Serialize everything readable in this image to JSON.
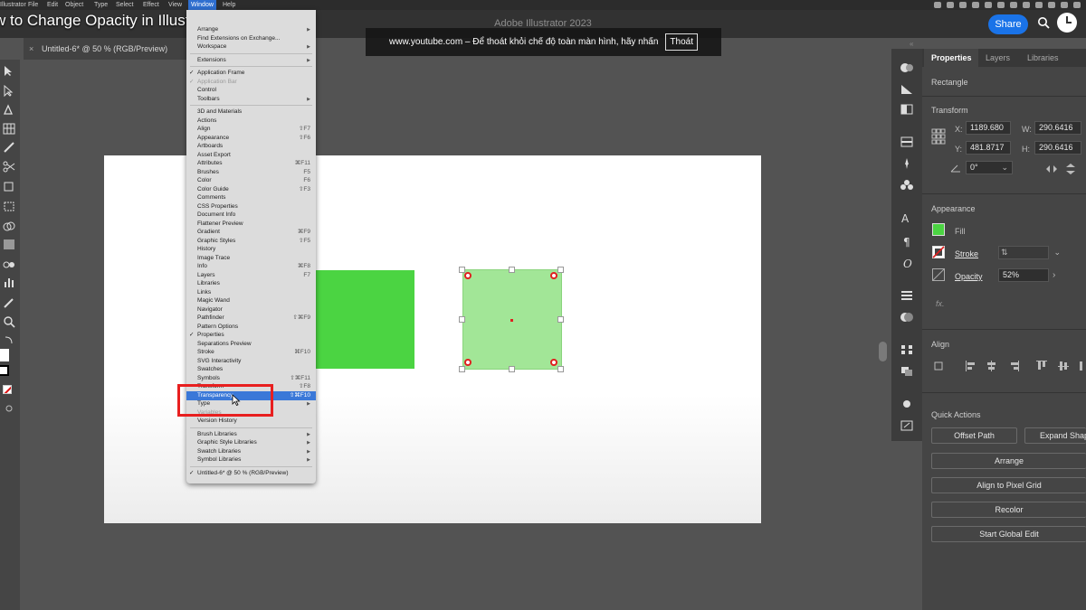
{
  "mac_menubar": {
    "app": "Illustrator",
    "items": [
      "File",
      "Edit",
      "Object",
      "Type",
      "Select",
      "Effect",
      "View",
      "Window",
      "Help"
    ]
  },
  "video_title": "w to Change Opacity in Illustrator",
  "app_title": "Adobe Illustrator 2023",
  "share_label": "Share",
  "fullscreen_notice": {
    "text": "www.youtube.com – Để thoát khỏi chế độ toàn màn hình, hãy nhấn",
    "button": "Thoát"
  },
  "document_tab": {
    "close": "×",
    "title": "Untitled-6* @ 50 % (RGB/Preview)"
  },
  "window_menu": {
    "items": [
      {
        "label": "Arrange",
        "arrow": true
      },
      {
        "label": "Find Extensions on Exchange..."
      },
      {
        "label": "Workspace",
        "arrow": true
      },
      {
        "sep": true
      },
      {
        "label": "Extensions",
        "arrow": true
      },
      {
        "sep": true
      },
      {
        "label": "Application Frame",
        "check": true
      },
      {
        "label": "Application Bar",
        "check": true,
        "disabled": true
      },
      {
        "label": "Control"
      },
      {
        "label": "Toolbars",
        "arrow": true
      },
      {
        "sep": true
      },
      {
        "label": "3D and Materials"
      },
      {
        "label": "Actions"
      },
      {
        "label": "Align",
        "shortcut": "⇧F7"
      },
      {
        "label": "Appearance",
        "shortcut": "⇧F6"
      },
      {
        "label": "Artboards"
      },
      {
        "label": "Asset Export"
      },
      {
        "label": "Attributes",
        "shortcut": "⌘F11"
      },
      {
        "label": "Brushes",
        "shortcut": "F5"
      },
      {
        "label": "Color",
        "shortcut": "F6"
      },
      {
        "label": "Color Guide",
        "shortcut": "⇧F3"
      },
      {
        "label": "Comments"
      },
      {
        "label": "CSS Properties"
      },
      {
        "label": "Document Info"
      },
      {
        "label": "Flattener Preview"
      },
      {
        "label": "Gradient",
        "shortcut": "⌘F9"
      },
      {
        "label": "Graphic Styles",
        "shortcut": "⇧F5"
      },
      {
        "label": "History"
      },
      {
        "label": "Image Trace"
      },
      {
        "label": "Info",
        "shortcut": "⌘F8"
      },
      {
        "label": "Layers",
        "shortcut": "F7"
      },
      {
        "label": "Libraries"
      },
      {
        "label": "Links"
      },
      {
        "label": "Magic Wand"
      },
      {
        "label": "Navigator"
      },
      {
        "label": "Pathfinder",
        "shortcut": "⇧⌘F9"
      },
      {
        "label": "Pattern Options"
      },
      {
        "label": "Properties",
        "check": true
      },
      {
        "label": "Separations Preview"
      },
      {
        "label": "Stroke",
        "shortcut": "⌘F10"
      },
      {
        "label": "SVG Interactivity"
      },
      {
        "label": "Swatches"
      },
      {
        "label": "Symbols",
        "shortcut": "⇧⌘F11"
      },
      {
        "label": "Transform",
        "shortcut": "⇧F8"
      },
      {
        "label": "Transparency",
        "shortcut": "⇧⌘F10",
        "highlight": true
      },
      {
        "label": "Type",
        "arrow": true
      },
      {
        "label": "Variables",
        "disabled": true
      },
      {
        "label": "Version History"
      },
      {
        "sep": true
      },
      {
        "label": "Brush Libraries",
        "arrow": true
      },
      {
        "label": "Graphic Style Libraries",
        "arrow": true
      },
      {
        "label": "Swatch Libraries",
        "arrow": true
      },
      {
        "label": "Symbol Libraries",
        "arrow": true
      },
      {
        "sep": true
      },
      {
        "label": "Untitled-6* @ 50 % (RGB/Preview)",
        "check": true
      }
    ]
  },
  "properties_panel": {
    "tabs": [
      "Properties",
      "Layers",
      "Libraries"
    ],
    "object_type": "Rectangle",
    "transform": {
      "heading": "Transform",
      "x_label": "X:",
      "x_value": "1189.680",
      "y_label": "Y:",
      "y_value": "481.8717",
      "w_label": "W:",
      "w_value": "290.6416",
      "h_label": "H:",
      "h_value": "290.6416",
      "angle_value": "0°"
    },
    "appearance": {
      "heading": "Appearance",
      "fill_label": "Fill",
      "stroke_label": "Stroke",
      "opacity_label": "Opacity",
      "opacity_value": "52%",
      "fx_label": "fx."
    },
    "align": {
      "heading": "Align"
    },
    "quick_actions": {
      "heading": "Quick Actions",
      "offset_path": "Offset Path",
      "expand_shape": "Expand Shape",
      "arrange": "Arrange",
      "align_pixel": "Align to Pixel Grid",
      "recolor": "Recolor",
      "global_edit": "Start Global Edit"
    }
  },
  "colors": {
    "fill_green": "#4bd442",
    "light_green": "#a2e697",
    "highlight": "#3a78d8",
    "red_box": "#e81f1f"
  },
  "icons": [
    "pointer-icon",
    "pen-icon",
    "grid-icon",
    "brush-icon",
    "scissors-icon",
    "zoom-icon",
    "search-icon",
    "clock-icon",
    "fill-swatch-icon",
    "stroke-swatch-icon"
  ]
}
